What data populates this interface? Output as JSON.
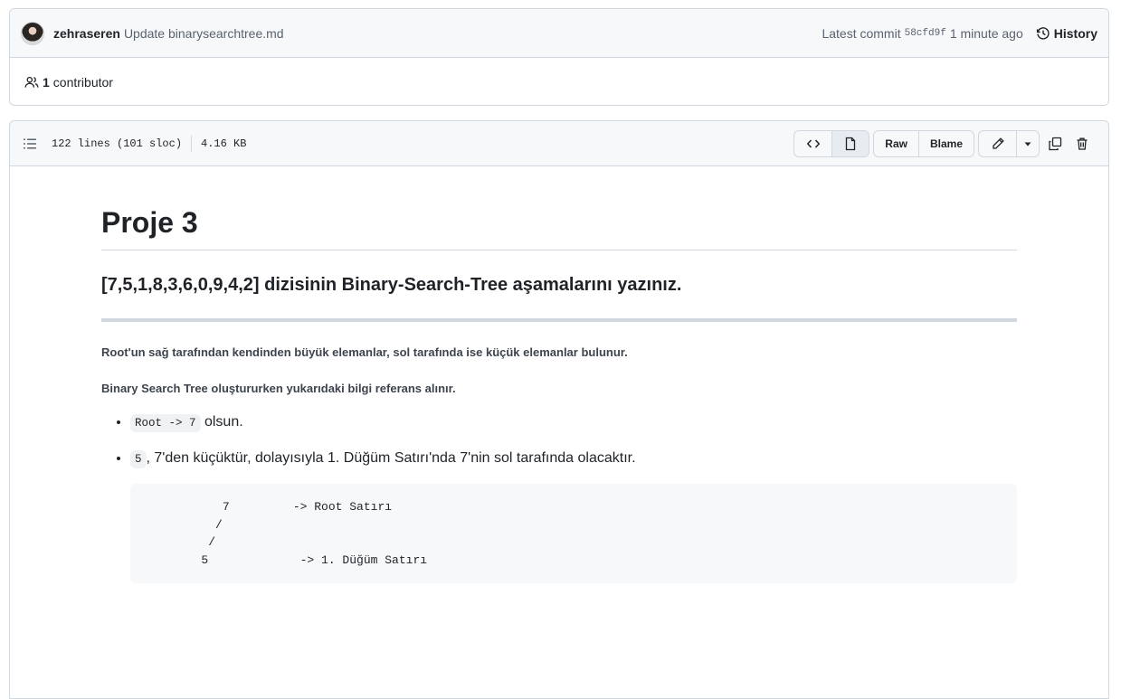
{
  "commit": {
    "author": "zehraseren",
    "message": "Update binarysearchtree.md",
    "latest_label": "Latest commit",
    "sha": "58cfd9f",
    "time": "1 minute ago",
    "history_label": "History"
  },
  "contributors": {
    "count": "1",
    "label": "contributor"
  },
  "file": {
    "lines": "122 lines (101 sloc)",
    "size": "4.16 KB",
    "raw_label": "Raw",
    "blame_label": "Blame"
  },
  "markdown": {
    "h1": "Proje 3",
    "h3": "[7,5,1,8,3,6,0,9,4,2] dizisinin Binary-Search-Tree aşamalarını yazınız.",
    "p1": "Root'un sağ tarafından kendinden büyük elemanlar, sol tarafında ise küçük elemanlar bulunur.",
    "p2": "Binary Search Tree oluştururken yukarıdaki bilgi referans alınır.",
    "li1_code": "Root -> 7",
    "li1_text": " olsun.",
    "li2_code": "5",
    "li2_text": ", 7'den küçüktür, dolayısıyla 1. Düğüm Satırı'nda 7'nin sol tarafında olacaktır.",
    "code_block": "           7         -> Root Satırı\n          /\n         /\n        5             -> 1. Düğüm Satırı"
  }
}
